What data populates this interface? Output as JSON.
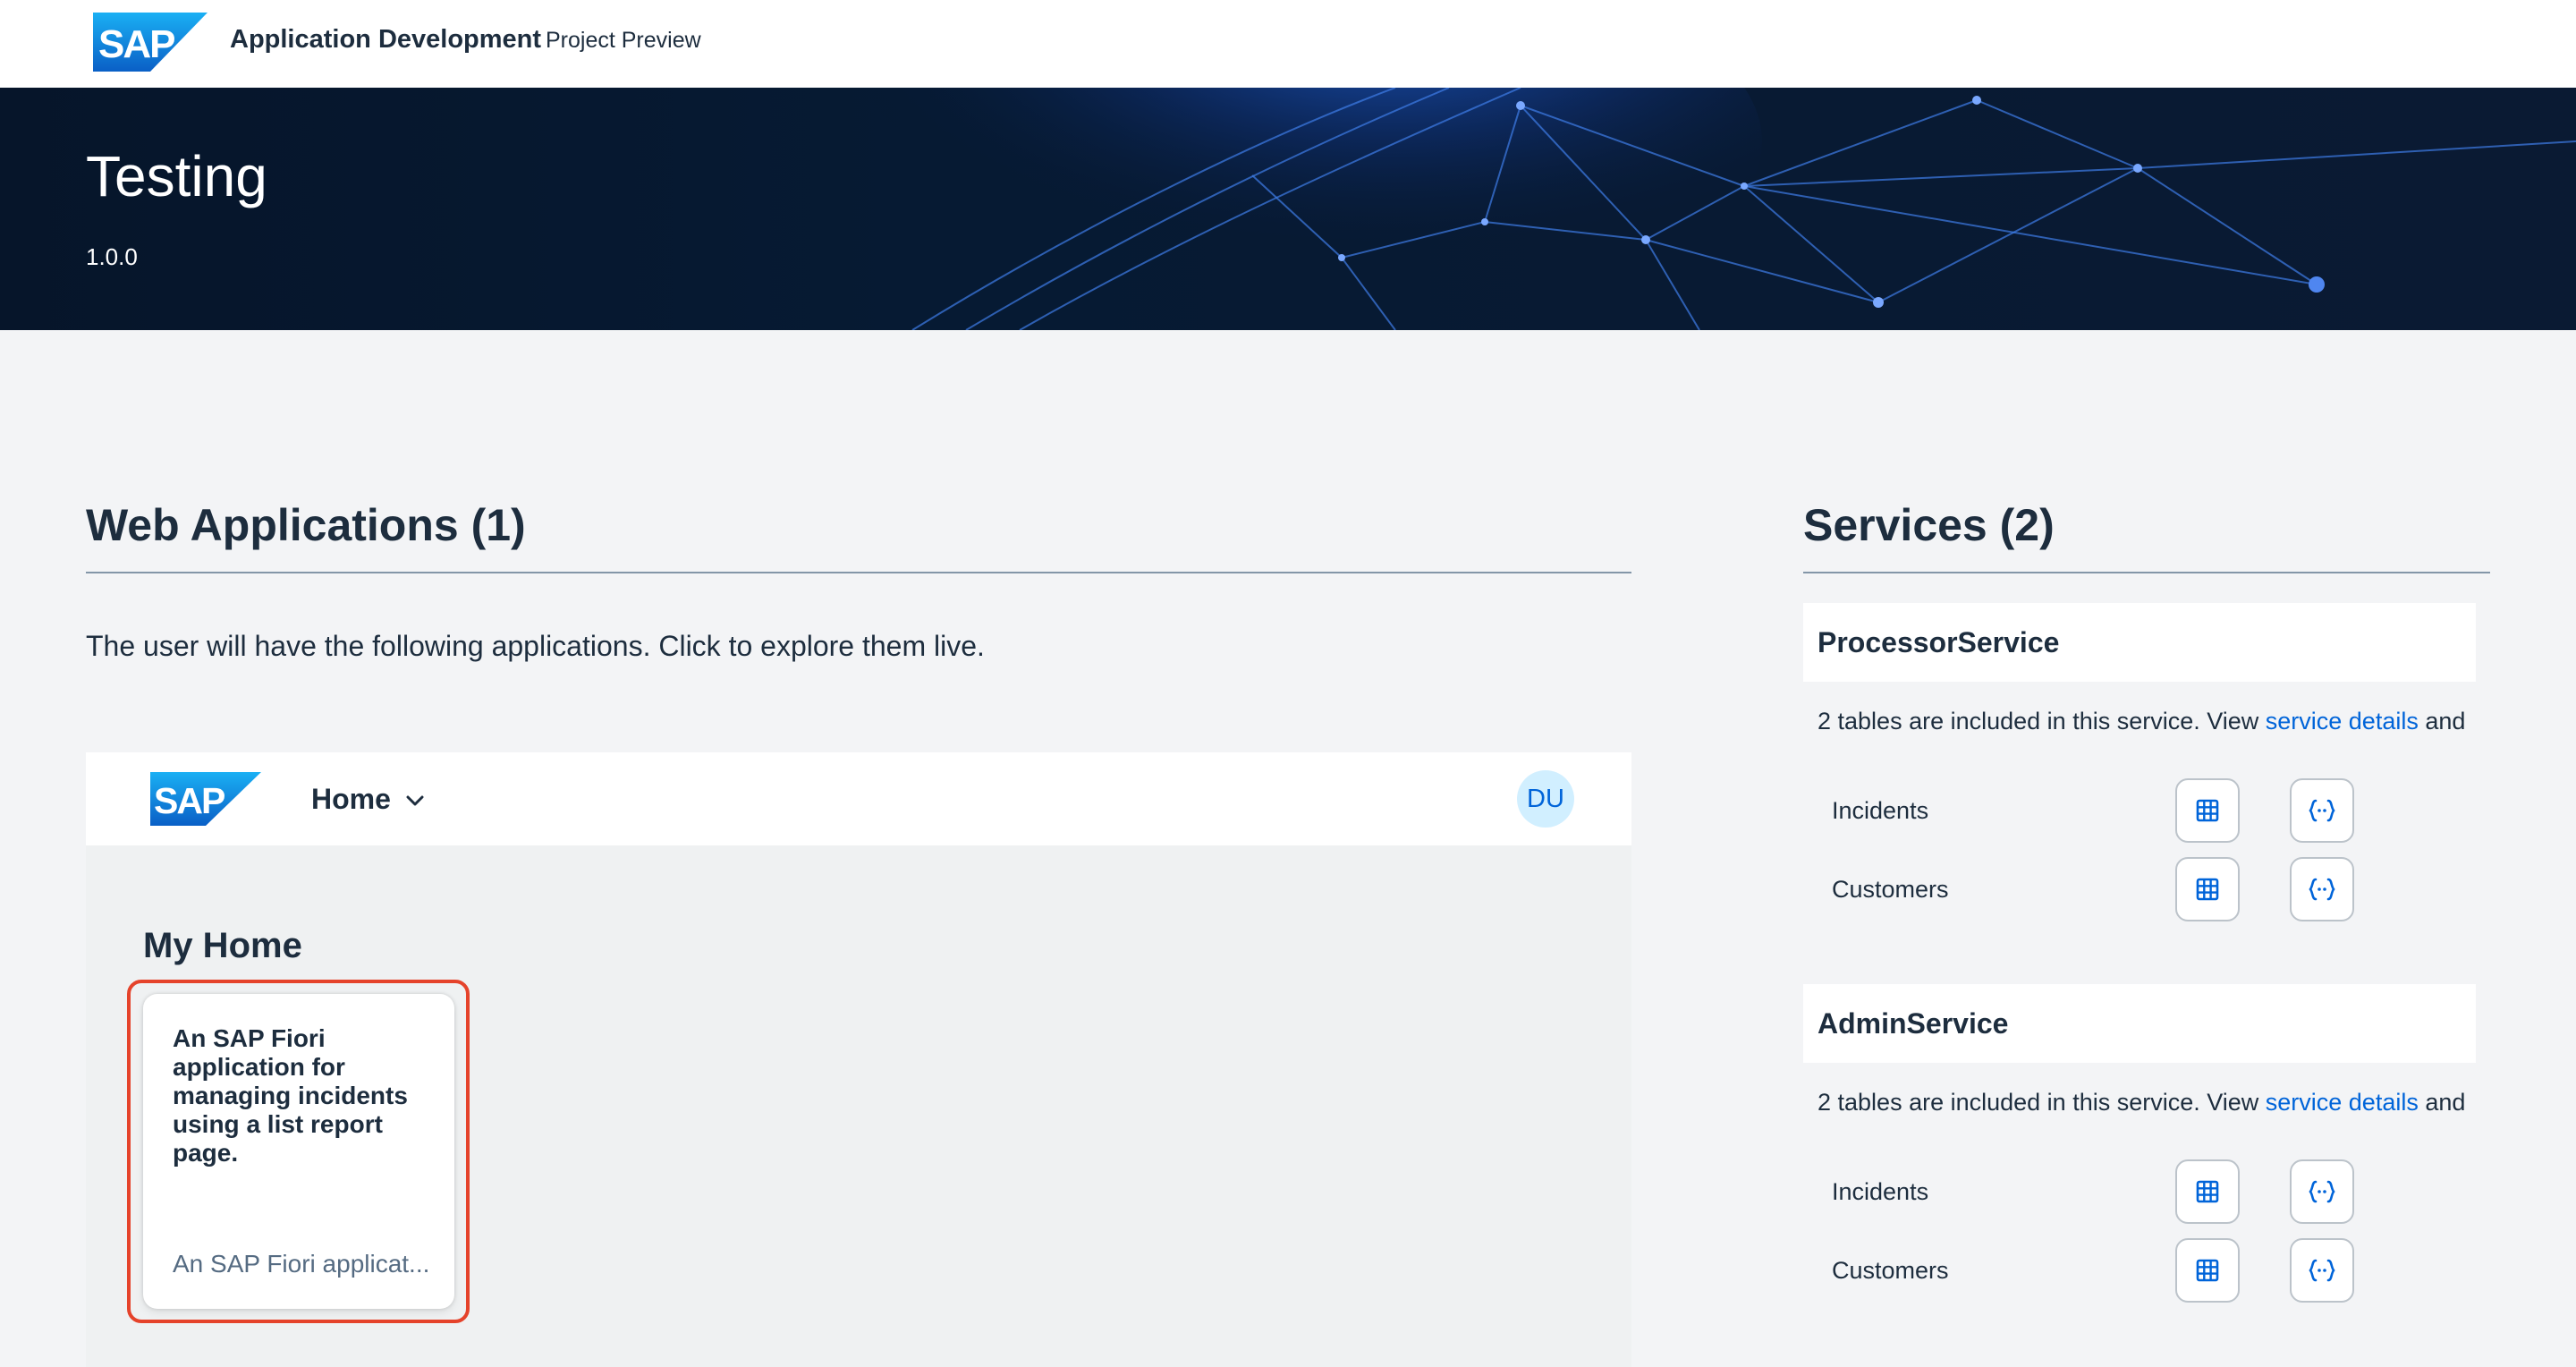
{
  "header": {
    "logo": "SAP",
    "title": "Application Development",
    "subtitle": "Project Preview"
  },
  "hero": {
    "title": "Testing",
    "version": "1.0.0"
  },
  "web_apps": {
    "title": "Web Applications (1)",
    "intro": "The user will have the following applications. Click to explore them live.",
    "launchpad": {
      "logo": "SAP",
      "home_label": "Home",
      "avatar_initials": "DU",
      "section_title": "My Home",
      "tile": {
        "title": "An SAP Fiori application for managing incidents using a list report page.",
        "subtitle": "An SAP Fiori applicat..."
      }
    }
  },
  "services": {
    "title": "Services (2)",
    "items": [
      {
        "name": "ProcessorService",
        "desc_prefix": "2 tables are included in this service. View ",
        "desc_link": "service details",
        "desc_suffix": " and",
        "tables": [
          "Incidents",
          "Customers"
        ]
      },
      {
        "name": "AdminService",
        "desc_prefix": "2 tables are included in this service. View ",
        "desc_link": "service details",
        "desc_suffix": " and",
        "tables": [
          "Incidents",
          "Customers"
        ]
      }
    ]
  },
  "colors": {
    "accent": "#0064d9",
    "highlight": "#e5432b",
    "hero_bg": "#06152a"
  },
  "icons": [
    "table-icon",
    "code-braces-icon",
    "chevron-down-icon"
  ]
}
